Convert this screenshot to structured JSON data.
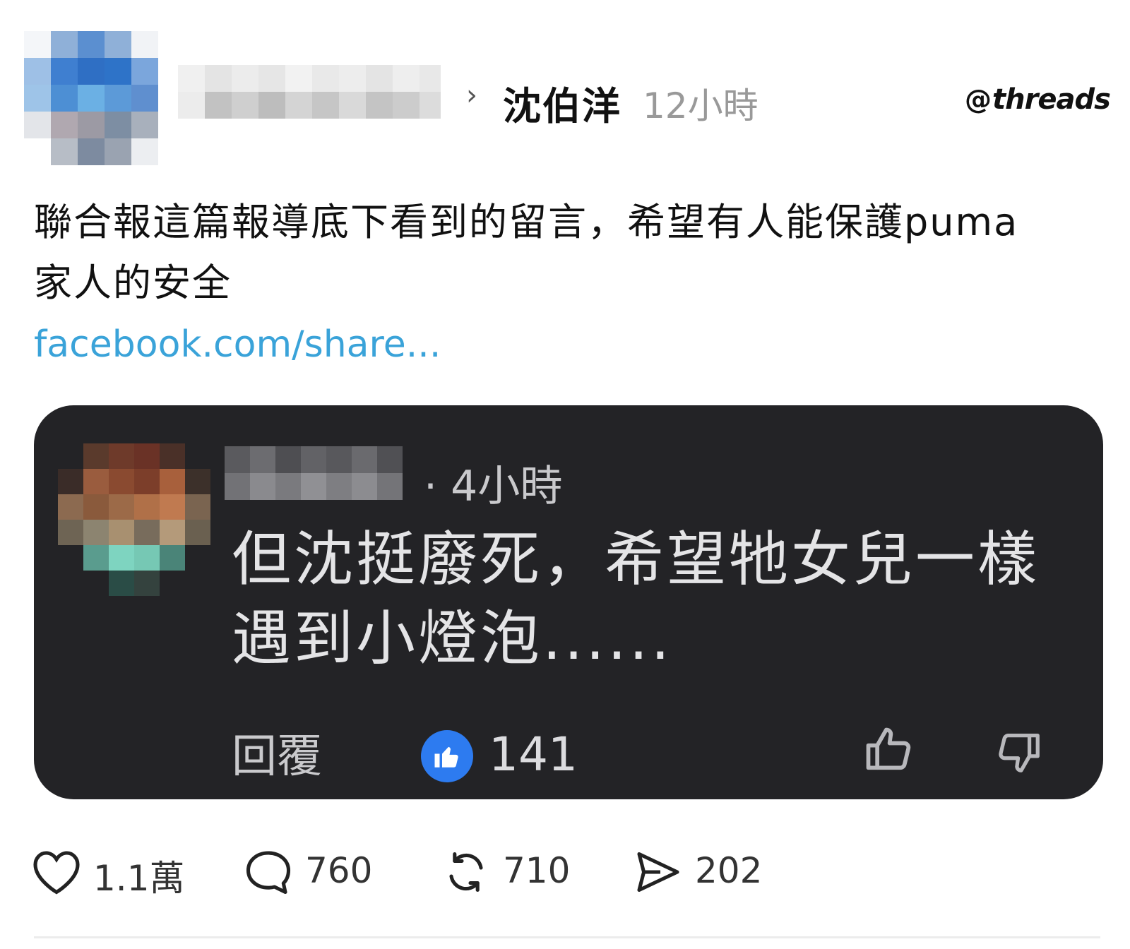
{
  "header": {
    "author_name": "沈伯洋",
    "time": "12小時",
    "brand": "threads",
    "brand_at": "@"
  },
  "post": {
    "text": "聯合報這篇報導底下看到的留言，希望有人能保護puma家人的安全",
    "link": "facebook.com/share..."
  },
  "quoted_comment": {
    "time": "· 4小時",
    "text": "但沈挺廢死，希望牠女兒一樣遇到小燈泡......",
    "reply_label": "回覆",
    "like_count": "141"
  },
  "actions": {
    "likes": "1.1萬",
    "comments": "760",
    "reposts": "710",
    "shares": "202"
  },
  "colors": {
    "link": "#3aa3d9",
    "card_bg": "#232326",
    "like_badge": "#2d7bf0"
  }
}
